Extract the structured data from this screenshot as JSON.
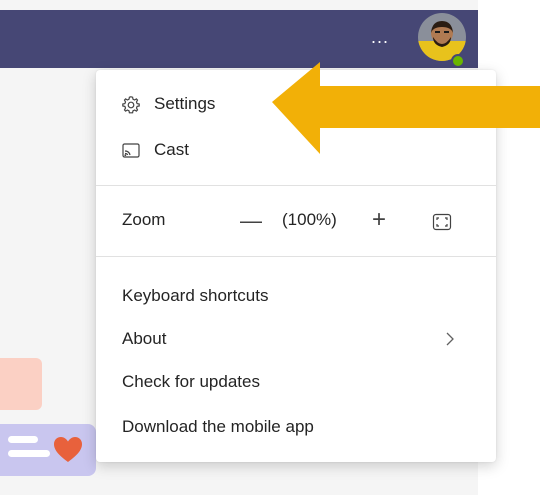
{
  "titlebar": {
    "more_label": "...",
    "status": "available"
  },
  "menu": {
    "settings_label": "Settings",
    "cast_label": "Cast",
    "zoom_label": "Zoom",
    "zoom_minus": "—",
    "zoom_value": "(100%)",
    "zoom_plus": "+",
    "keyboard_shortcuts_label": "Keyboard shortcuts",
    "about_label": "About",
    "check_updates_label": "Check for updates",
    "download_mobile_label": "Download the mobile app"
  },
  "colors": {
    "titlebar": "#464775",
    "presence": "#6bb700",
    "annotation_arrow": "#f2b007"
  },
  "icons": {
    "settings": "gear-icon",
    "cast": "cast-icon",
    "fullscreen": "fullscreen-icon",
    "about_chevron": "chevron-right-icon"
  }
}
